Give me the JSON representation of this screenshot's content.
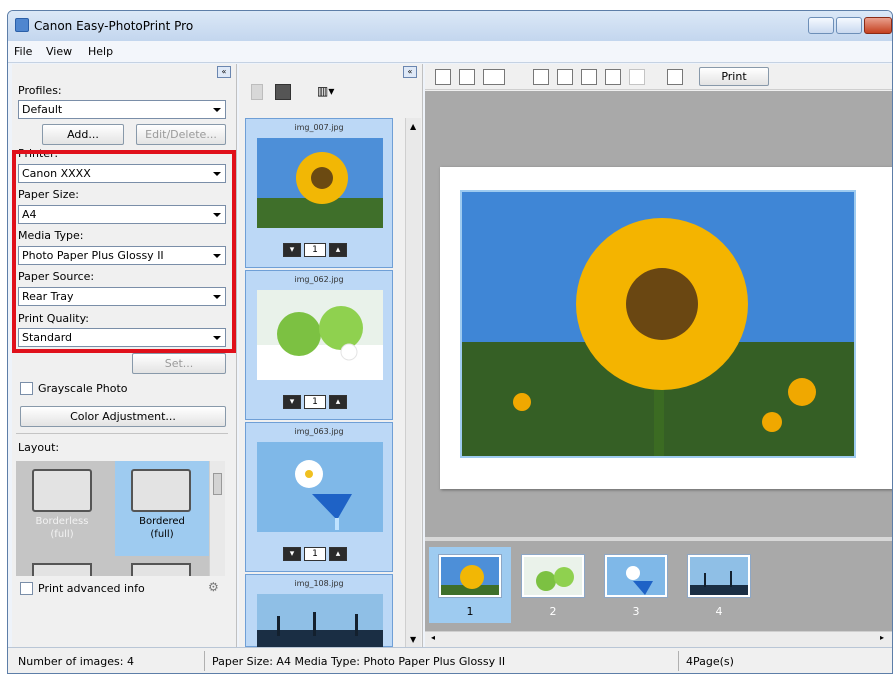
{
  "window": {
    "title": "Canon Easy-PhotoPrint Pro"
  },
  "menu": {
    "items": [
      "File",
      "View",
      "Help"
    ]
  },
  "left_panel": {
    "profiles_label": "Profiles:",
    "profile_value": "Default",
    "add_button": "Add...",
    "edit_delete_button": "Edit/Delete...",
    "printer_label": "Printer:",
    "printer_value": "Canon XXXX",
    "paper_size_label": "Paper Size:",
    "paper_size_value": "A4",
    "media_type_label": "Media Type:",
    "media_type_value": "Photo Paper Plus Glossy II",
    "paper_source_label": "Paper Source:",
    "paper_source_value": "Rear Tray",
    "print_quality_label": "Print Quality:",
    "print_quality_value": "Standard",
    "set_button": "Set...",
    "grayscale_label": "Grayscale Photo",
    "color_adjustment_button": "Color Adjustment...",
    "layout_label": "Layout:",
    "layouts": [
      {
        "name": "Borderless",
        "sub": "(full)"
      },
      {
        "name": "Bordered",
        "sub": "(full)"
      }
    ],
    "print_advanced_label": "Print advanced info",
    "highlight_color": "#e0101b"
  },
  "image_list": {
    "items": [
      {
        "file": "img_007.jpg",
        "count": "1"
      },
      {
        "file": "img_062.jpg",
        "count": "1"
      },
      {
        "file": "img_063.jpg",
        "count": "1"
      },
      {
        "file": "img_108.jpg",
        "count": ""
      }
    ]
  },
  "preview": {
    "print_button": "Print"
  },
  "strip": {
    "pages": [
      "1",
      "2",
      "3",
      "4"
    ]
  },
  "status": {
    "images": "Number of images: 4",
    "paper": "Paper Size: A4  Media Type: Photo Paper Plus Glossy II",
    "pages": "4Page(s)"
  }
}
